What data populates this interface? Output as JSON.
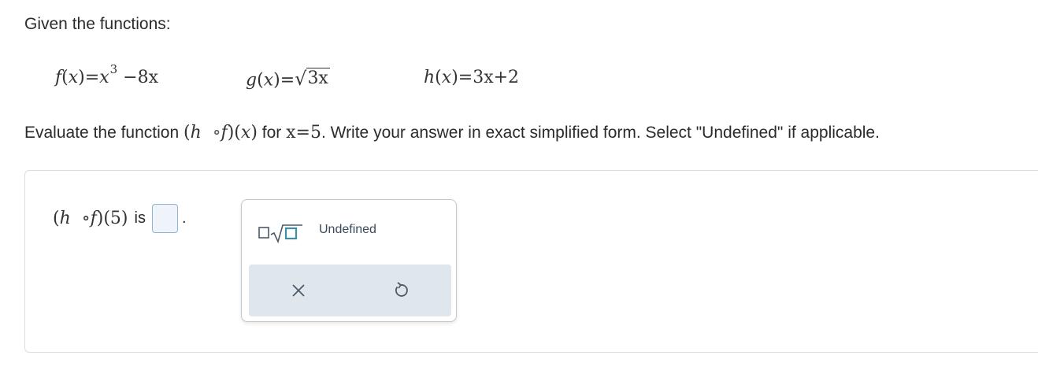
{
  "intro": {
    "text": "Given the functions:"
  },
  "functions": {
    "f": {
      "name": "f",
      "var": "x",
      "expr_base": "x",
      "expr_exp": "3",
      "expr_rest": "−8x"
    },
    "g": {
      "name": "g",
      "var": "x",
      "radicand": "3x"
    },
    "h": {
      "name": "h",
      "var": "x",
      "expr": "3x+2"
    }
  },
  "prompt": {
    "before": "Evaluate the function",
    "composition_outer": "h",
    "composition_op": "∘",
    "composition_inner": "f",
    "composition_var": "x",
    "middle": "for",
    "condition": "x=5",
    "after": ". Write your answer in exact simplified form. Select \"Undefined\" if applicable."
  },
  "answer": {
    "outer": "h",
    "op": "∘",
    "inner": "f",
    "arg": "5",
    "is_label": "is",
    "value": "",
    "period": "."
  },
  "palette": {
    "sqrt_tool_icon": "square-root-template-icon",
    "undefined_label": "Undefined",
    "clear_icon": "close-icon",
    "undo_icon": "undo-icon"
  },
  "colors": {
    "input_border": "#8fb3cf",
    "input_fill": "#eef4f9",
    "tray_bg": "#dfe6ec",
    "icon_color": "#4a5a68",
    "accent_teal": "#3c8fa7"
  }
}
